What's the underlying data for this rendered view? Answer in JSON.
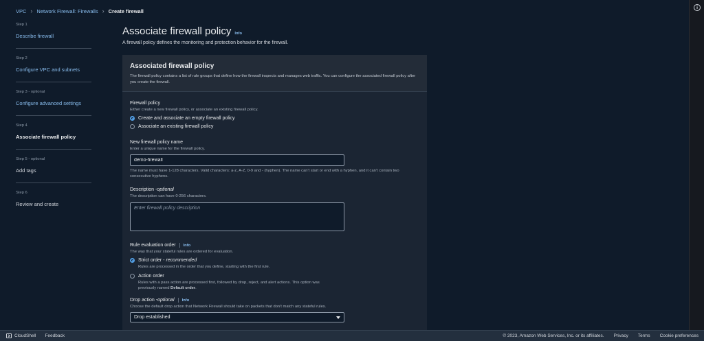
{
  "breadcrumb": {
    "items": [
      "VPC",
      "Network Firewall: Firewalls"
    ],
    "current": "Create firewall",
    "separator": "›"
  },
  "steps": [
    {
      "label": "Step 1",
      "title": "Describe firewall"
    },
    {
      "label": "Step 2",
      "title": "Configure VPC and subnets"
    },
    {
      "label": "Step 3 - optional",
      "title": "Configure advanced settings"
    },
    {
      "label": "Step 4",
      "title": "Associate firewall policy"
    },
    {
      "label": "Step 5 - optional",
      "title": "Add tags"
    },
    {
      "label": "Step 6",
      "title": "Review and create"
    }
  ],
  "page": {
    "title": "Associate firewall policy",
    "info": "Info",
    "description": "A firewall policy defines the monitoring and protection behavior for the firewall."
  },
  "panel": {
    "title": "Associated firewall policy",
    "description": "The firewall policy contains a list of rule groups that define how the firewall inspects and manages web traffic. You can configure the associated firewall policy after you create the firewall."
  },
  "firewall_policy": {
    "label": "Firewall policy",
    "description": "Either create a new firewall policy, or associate an existing firewall policy.",
    "options": [
      "Create and associate an empty firewall policy",
      "Associate an existing firewall policy"
    ],
    "selected_index": 0
  },
  "policy_name": {
    "label": "New firewall policy name",
    "description": "Enter a unique name for the firewall policy.",
    "value": "demo-firewall",
    "hint": "The name must have 1-128 characters. Valid characters: a-z, A-Z, 0-9 and - (hyphen). The name can't start or end with a hyphen, and it can't contain two consecutive hyphens."
  },
  "policy_description": {
    "label": "Description - ",
    "label_optional": "optional",
    "description": "The description can have 0-256 characters.",
    "placeholder": "Enter firewall policy description"
  },
  "rule_order": {
    "label": "Rule evaluation order",
    "info": "Info",
    "description": "The way that your stateful rules are ordered for evaluation.",
    "options": [
      {
        "label": "Strict order - ",
        "label_em": "recommended",
        "sub": "Rules are processed in the order that you define, starting with the first rule."
      },
      {
        "label": "Action order",
        "label_em": "",
        "sub": "Rules with a pass action are processed first, followed by drop, reject, and alert actions. This option was previously named ",
        "sub_bold": "Default order",
        "sub_end": "."
      }
    ],
    "selected_index": 0
  },
  "drop_action": {
    "label": "Drop action - ",
    "label_optional": "optional",
    "info": "Info",
    "description": "Choose the default drop action that Network Firewall should take on packets that don't match any stateful rules.",
    "value": "Drop established"
  },
  "footer": {
    "cloudshell": "CloudShell",
    "feedback": "Feedback",
    "copyright": "© 2023, Amazon Web Services, Inc. or its affiliates.",
    "privacy": "Privacy",
    "terms": "Terms",
    "cookies": "Cookie preferences"
  },
  "colors": {
    "background": "#0f1b2a",
    "link": "#89bdee",
    "radio_selected": "#539fe5"
  }
}
